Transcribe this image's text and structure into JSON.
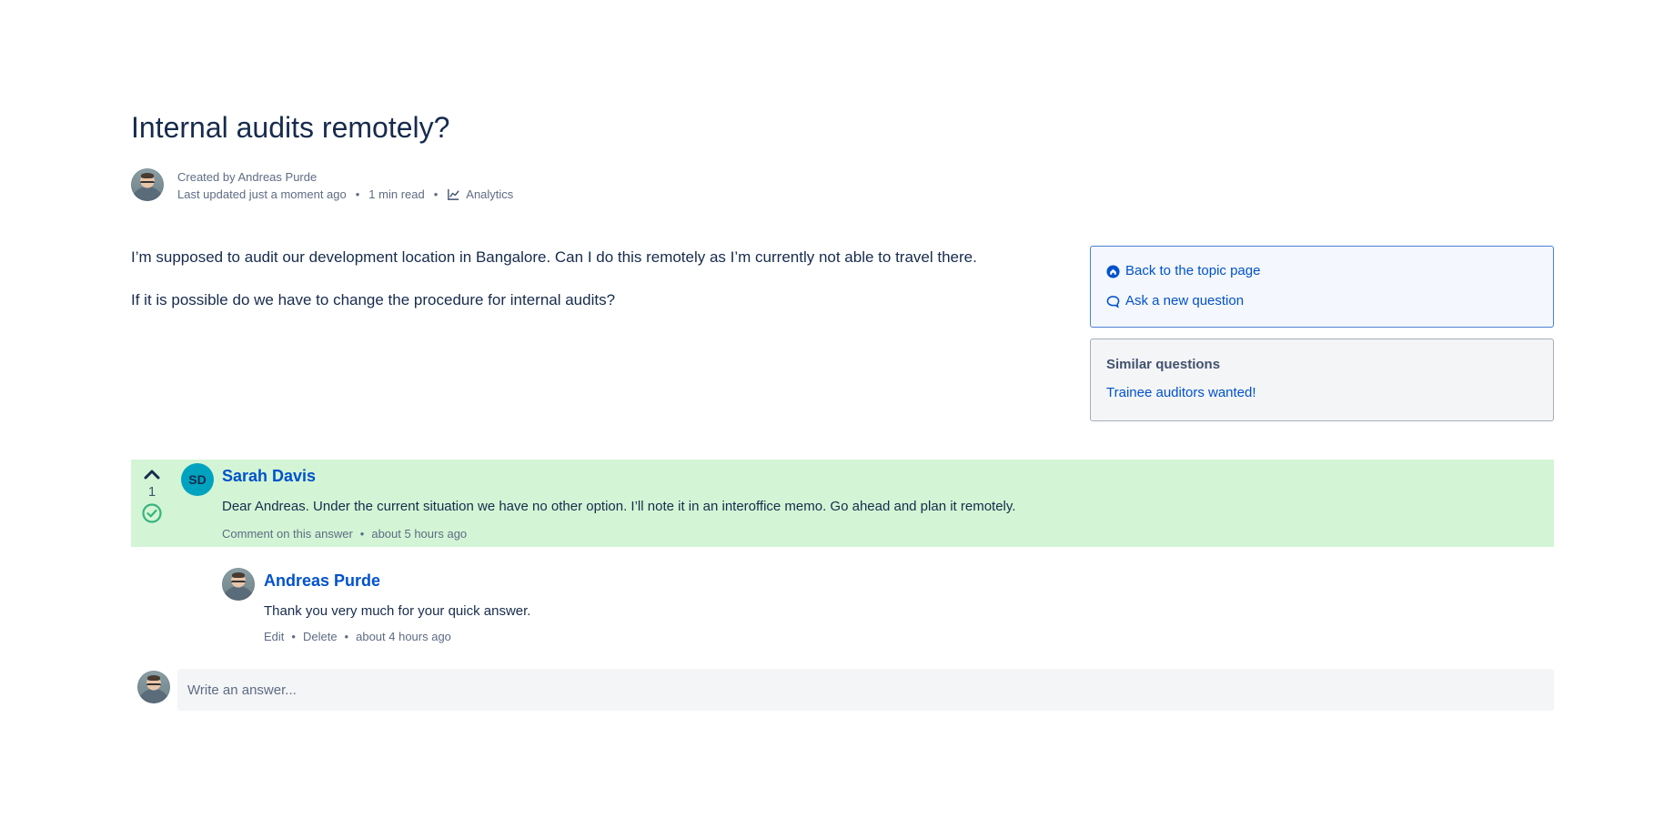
{
  "page": {
    "title": "Internal audits remotely?"
  },
  "byline": {
    "created_by": "Created by Andreas Purde",
    "last_updated": "Last updated just a moment ago",
    "read_time": "1 min read",
    "analytics": "Analytics",
    "separator": "•",
    "icon": "analytics-chart-icon"
  },
  "question": {
    "paragraphs": [
      "I’m supposed to audit our development location in Bangalore. Can I do this remotely as I’m currently not able to travel there.",
      "If it is possible do we have to change the procedure for internal audits?"
    ]
  },
  "sidebar": {
    "back_link": "Back to the topic page",
    "back_icon": "home-icon",
    "ask_link": "Ask a new question",
    "ask_icon": "speech-bubble-icon",
    "similar_title": "Similar questions",
    "similar_items": [
      "Trainee auditors wanted!"
    ]
  },
  "answer": {
    "author_initials": "SD",
    "author": "Sarah Davis",
    "votes": "1",
    "body": "Dear Andreas. Under the current situation we have no other option. I’ll note it in an interoffice memo. Go ahead and plan it remotely.",
    "comment_link": "Comment on this answer",
    "time": "about 5 hours ago",
    "separator": "•",
    "background": "#d3f5d5",
    "accepted_color": "#36b37e"
  },
  "comment": {
    "author": "Andreas Purde",
    "body": "Thank you very much for your quick answer.",
    "edit": "Edit",
    "delete": "Delete",
    "time": "about 4 hours ago",
    "separator": "•"
  },
  "composer": {
    "placeholder": "Write an answer..."
  },
  "colors": {
    "link": "#0052cc",
    "text": "#172b4d",
    "muted": "#5e6c84"
  }
}
